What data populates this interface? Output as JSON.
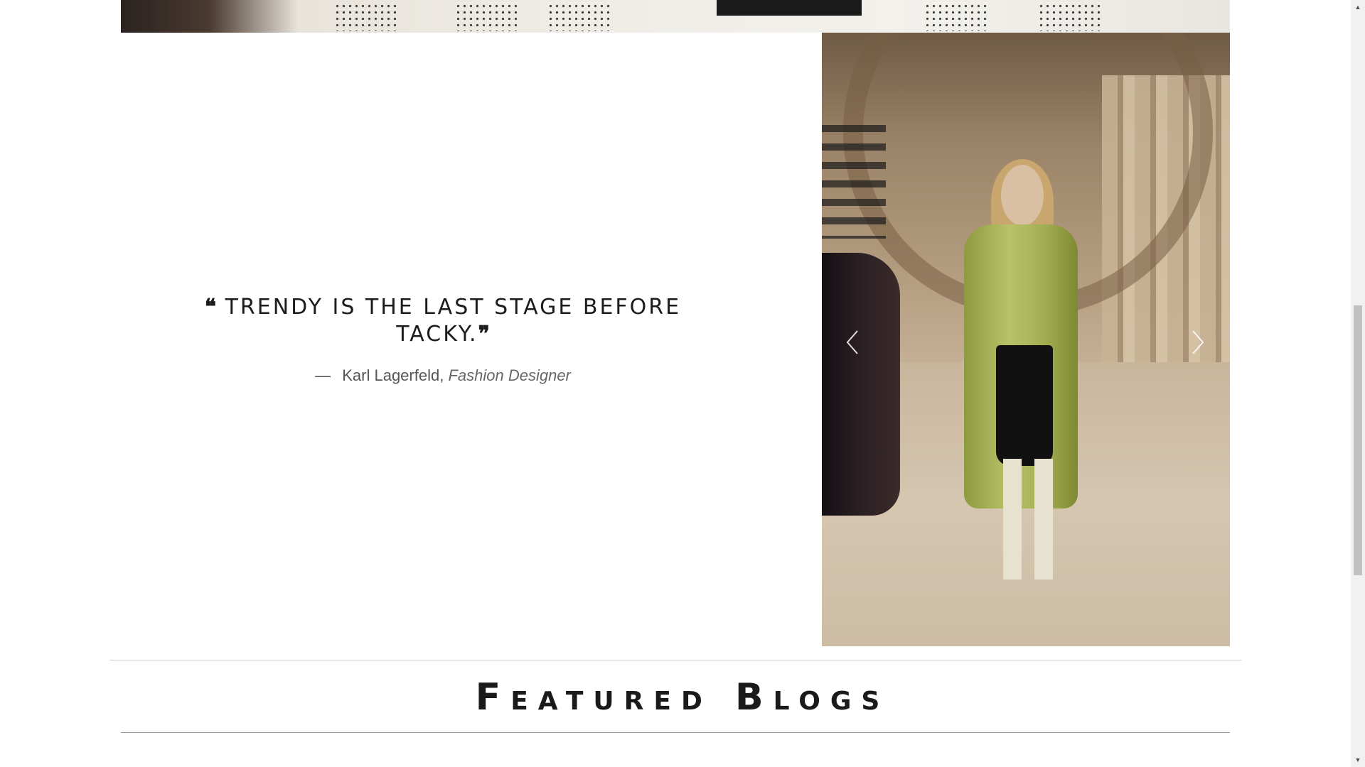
{
  "quote": {
    "open_mark": "❝",
    "text": "Trendy is the last stage before tacky.",
    "close_mark": "❞",
    "dash": "—",
    "author": "Karl Lagerfeld,",
    "role": "Fashion Designer"
  },
  "slider": {
    "prev_icon": "chevron-left-icon",
    "next_icon": "chevron-right-icon"
  },
  "featured": {
    "title": "Featured Blogs"
  },
  "scrollbar": {
    "up_glyph": "▲",
    "down_glyph": "▼"
  },
  "colors": {
    "text": "#1c1c1c",
    "muted": "#555555",
    "rule": "#cfcfcf",
    "coat": "#b9c26a"
  }
}
